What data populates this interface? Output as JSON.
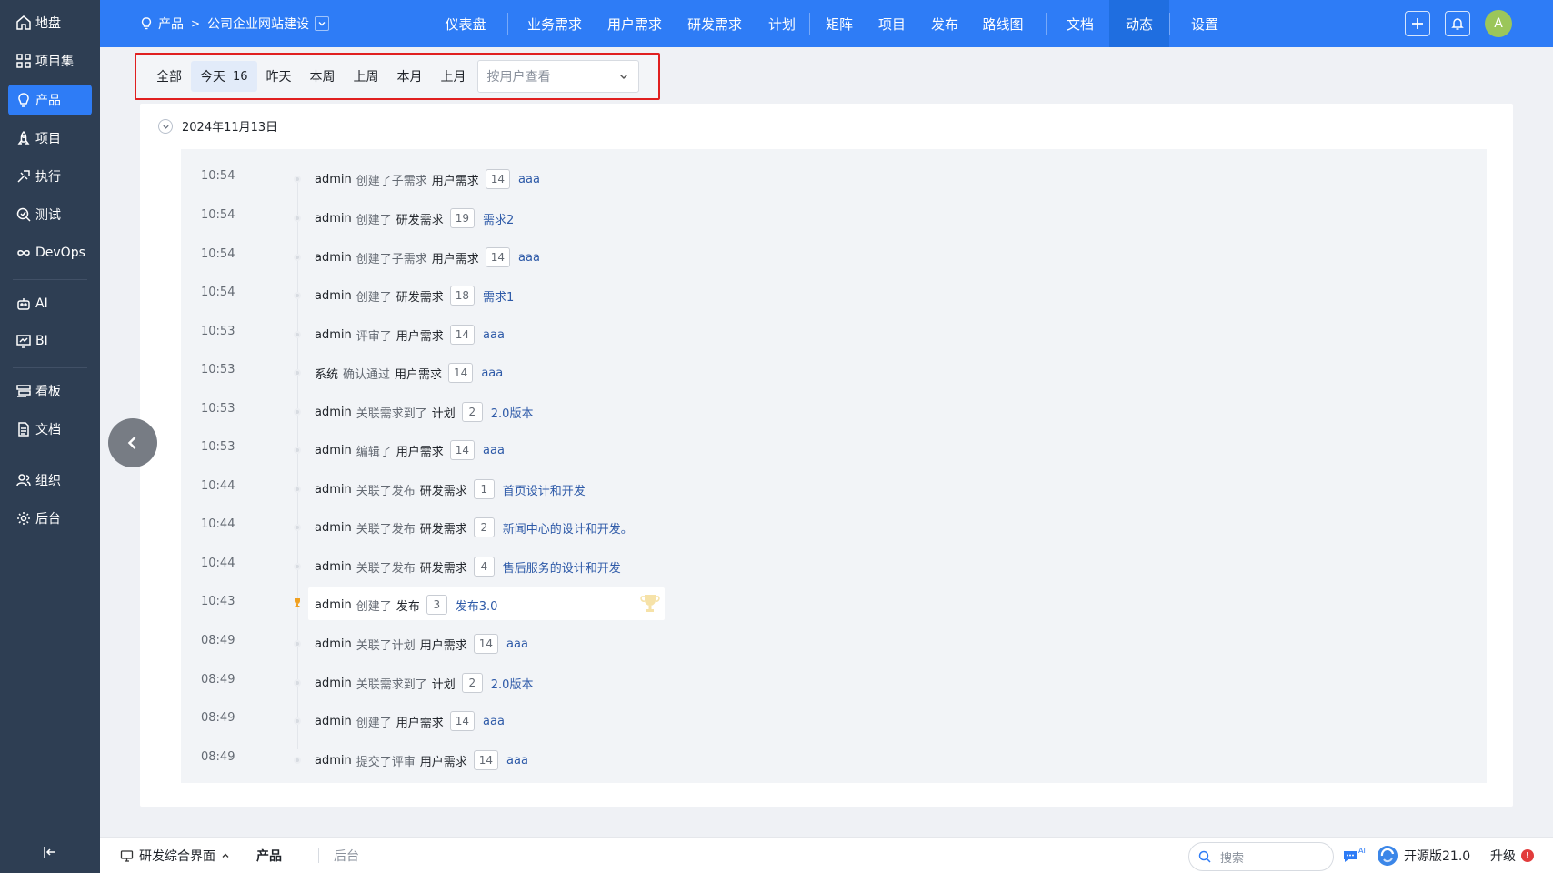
{
  "sidebar": {
    "items": [
      {
        "label": "地盘",
        "icon": "home-icon"
      },
      {
        "label": "项目集",
        "icon": "grid-icon"
      },
      {
        "label": "产品",
        "icon": "bulb-icon"
      },
      {
        "label": "项目",
        "icon": "rocket-icon"
      },
      {
        "label": "执行",
        "icon": "execute-icon"
      },
      {
        "label": "测试",
        "icon": "test-icon"
      },
      {
        "label": "DevOps",
        "icon": "infinity-icon"
      },
      {
        "label": "AI",
        "icon": "robot-icon"
      },
      {
        "label": "BI",
        "icon": "chart-icon"
      },
      {
        "label": "看板",
        "icon": "kanban-icon"
      },
      {
        "label": "文档",
        "icon": "document-icon"
      },
      {
        "label": "组织",
        "icon": "people-icon"
      },
      {
        "label": "后台",
        "icon": "gear-icon"
      }
    ],
    "active_label": "产品"
  },
  "header": {
    "breadcrumb_root": "产品",
    "breadcrumb_product": "公司企业网站建设",
    "nav": [
      "仪表盘",
      "业务需求",
      "用户需求",
      "研发需求",
      "计划",
      "矩阵",
      "项目",
      "发布",
      "路线图",
      "文档",
      "动态",
      "设置"
    ],
    "active_nav": "动态",
    "avatar_letter": "A"
  },
  "filters": {
    "all": "全部",
    "today": "今天",
    "today_count": "16",
    "yesterday": "昨天",
    "this_week": "本周",
    "last_week": "上周",
    "this_month": "本月",
    "last_month": "上月",
    "user_select_placeholder": "按用户查看"
  },
  "timeline": {
    "date": "2024年11月13日",
    "rows": [
      {
        "time": "10:54",
        "actor": "admin",
        "action": "创建了子需求",
        "obj": "用户需求",
        "id": "14",
        "name": "aaa"
      },
      {
        "time": "10:54",
        "actor": "admin",
        "action": "创建了",
        "obj": "研发需求",
        "id": "19",
        "name": "需求2"
      },
      {
        "time": "10:54",
        "actor": "admin",
        "action": "创建了子需求",
        "obj": "用户需求",
        "id": "14",
        "name": "aaa"
      },
      {
        "time": "10:54",
        "actor": "admin",
        "action": "创建了",
        "obj": "研发需求",
        "id": "18",
        "name": "需求1"
      },
      {
        "time": "10:53",
        "actor": "admin",
        "action": "评审了",
        "obj": "用户需求",
        "id": "14",
        "name": "aaa"
      },
      {
        "time": "10:53",
        "actor": "系统",
        "action": "确认通过",
        "obj": "用户需求",
        "id": "14",
        "name": "aaa"
      },
      {
        "time": "10:53",
        "actor": "admin",
        "action": "关联需求到了",
        "obj": "计划",
        "id": "2",
        "name": "2.0版本"
      },
      {
        "time": "10:53",
        "actor": "admin",
        "action": "编辑了",
        "obj": "用户需求",
        "id": "14",
        "name": "aaa"
      },
      {
        "time": "10:44",
        "actor": "admin",
        "action": "关联了发布",
        "obj": "研发需求",
        "id": "1",
        "name": "首页设计和开发"
      },
      {
        "time": "10:44",
        "actor": "admin",
        "action": "关联了发布",
        "obj": "研发需求",
        "id": "2",
        "name": "新闻中心的设计和开发。"
      },
      {
        "time": "10:44",
        "actor": "admin",
        "action": "关联了发布",
        "obj": "研发需求",
        "id": "4",
        "name": "售后服务的设计和开发"
      },
      {
        "time": "10:43",
        "actor": "admin",
        "action": "创建了",
        "obj": "发布",
        "id": "3",
        "name": "发布3.0"
      },
      {
        "time": "08:49",
        "actor": "admin",
        "action": "关联了计划",
        "obj": "用户需求",
        "id": "14",
        "name": "aaa"
      },
      {
        "time": "08:49",
        "actor": "admin",
        "action": "关联需求到了",
        "obj": "计划",
        "id": "2",
        "name": "2.0版本"
      },
      {
        "time": "08:49",
        "actor": "admin",
        "action": "创建了",
        "obj": "用户需求",
        "id": "14",
        "name": "aaa"
      },
      {
        "time": "08:49",
        "actor": "admin",
        "action": "提交了评审",
        "obj": "用户需求",
        "id": "14",
        "name": "aaa"
      }
    ]
  },
  "bottombar": {
    "workspace": "研发综合界面",
    "tab_product": "产品",
    "tab_admin": "后台",
    "search_placeholder": "搜索",
    "ai_badge": "AI",
    "version": "开源版21.0",
    "upgrade": "升级",
    "upgrade_badge": "!"
  },
  "colors": {
    "primary": "#2e7cf6",
    "sidebar_bg": "#2e3e53",
    "highlight_border": "#e02020",
    "link": "#2e5aa8"
  }
}
